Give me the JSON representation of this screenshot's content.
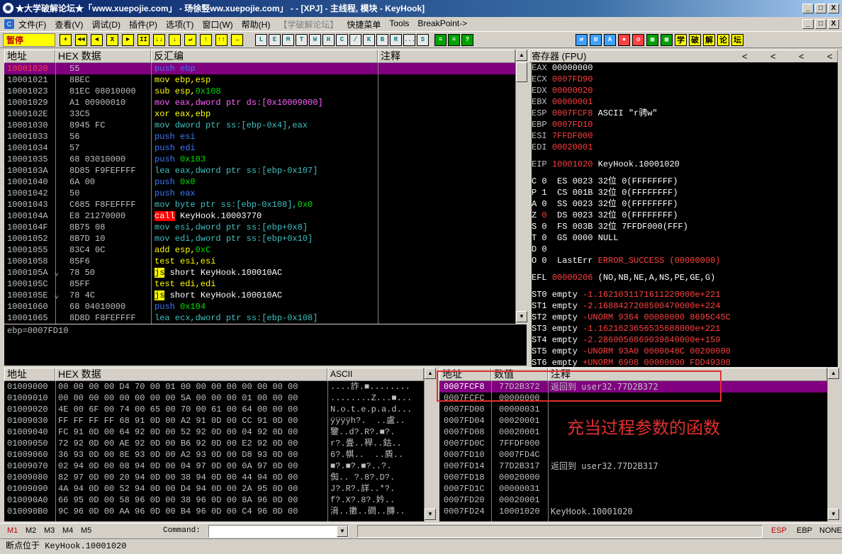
{
  "window": {
    "title": "★大学破解论坛★「www.xuepojie.com」 - 玚徐竪ww.xuepojie.com」 - - [XPJ] - 主线程, 模块 - KeyHook]",
    "min_label": "_",
    "max_label": "□",
    "close_label": "X"
  },
  "menu": [
    {
      "label": "文件(F)",
      "enabled": true
    },
    {
      "label": "查看(V)",
      "enabled": true
    },
    {
      "label": "调试(D)",
      "enabled": true
    },
    {
      "label": "插件(P)",
      "enabled": true
    },
    {
      "label": "选项(T)",
      "enabled": true
    },
    {
      "label": "窗口(W)",
      "enabled": true
    },
    {
      "label": "帮助(H)",
      "enabled": true
    },
    {
      "label": "【学破解论坛】",
      "enabled": false
    },
    {
      "label": "快捷菜单",
      "enabled": true
    },
    {
      "label": "Tools",
      "enabled": true
    },
    {
      "label": "BreakPoint->",
      "enabled": true
    }
  ],
  "toolbar": {
    "state": "暂停",
    "buttons_left": [
      "+",
      "◄◄",
      "◄",
      "X",
      "►",
      "II",
      "↓↓",
      "↓",
      "↵",
      "↑",
      "↑↑",
      "→"
    ],
    "buttons_letters": [
      "L",
      "E",
      "M",
      "T",
      "W",
      "H",
      "C",
      "/",
      "K",
      "B",
      "R",
      "...",
      "S"
    ],
    "buttons_right": [
      "≡",
      "≡",
      "?"
    ],
    "buttons_plugins": [
      "⇄",
      "⊞",
      "A",
      "●",
      "◎",
      "▦",
      "▦",
      "学",
      "破",
      "解",
      "论",
      "坛"
    ]
  },
  "disasm": {
    "headers": {
      "addr": "地址",
      "hex": "HEX 数据",
      "dis": "反汇编",
      "comment": "注释"
    },
    "rows": [
      {
        "addr": "10001020",
        "mark": "",
        "hex": "55",
        "parts": [
          {
            "t": "push ebp",
            "c": "blue"
          }
        ],
        "sel": true
      },
      {
        "addr": "10001021",
        "mark": "",
        "hex": "8BEC",
        "parts": [
          {
            "t": "mov ebp,esp",
            "c": "yellow"
          }
        ]
      },
      {
        "addr": "10001023",
        "mark": "",
        "hex": "81EC 08010000",
        "parts": [
          {
            "t": "sub esp,",
            "c": "yellow"
          },
          {
            "t": "0x108",
            "c": "green"
          }
        ]
      },
      {
        "addr": "10001029",
        "mark": "",
        "hex": "A1 00900010",
        "parts": [
          {
            "t": "mov eax,dword ptr ds:[0x10009000]",
            "c": "magenta"
          }
        ]
      },
      {
        "addr": "1000102E",
        "mark": "",
        "hex": "33C5",
        "parts": [
          {
            "t": "xor eax,ebp",
            "c": "yellow"
          }
        ]
      },
      {
        "addr": "10001030",
        "mark": "",
        "hex": "8945 FC",
        "parts": [
          {
            "t": "mov dword ptr ss:[ebp-0x4],eax",
            "c": "cyan"
          }
        ]
      },
      {
        "addr": "10001033",
        "mark": "",
        "hex": "56",
        "parts": [
          {
            "t": "push esi",
            "c": "blue"
          }
        ]
      },
      {
        "addr": "10001034",
        "mark": "",
        "hex": "57",
        "parts": [
          {
            "t": "push edi",
            "c": "blue"
          }
        ]
      },
      {
        "addr": "10001035",
        "mark": "",
        "hex": "68 03010000",
        "parts": [
          {
            "t": "push ",
            "c": "blue"
          },
          {
            "t": "0x103",
            "c": "green"
          }
        ]
      },
      {
        "addr": "1000103A",
        "mark": "",
        "hex": "8D85 F9FEFFFF",
        "parts": [
          {
            "t": "lea eax,dword ptr ss:[ebp-0x107]",
            "c": "cyan"
          }
        ]
      },
      {
        "addr": "10001040",
        "mark": "",
        "hex": "6A 00",
        "parts": [
          {
            "t": "push ",
            "c": "blue"
          },
          {
            "t": "0x0",
            "c": "green"
          }
        ]
      },
      {
        "addr": "10001042",
        "mark": "",
        "hex": "50",
        "parts": [
          {
            "t": "push eax",
            "c": "blue"
          }
        ]
      },
      {
        "addr": "10001043",
        "mark": "",
        "hex": "C685 F8FEFFFF",
        "parts": [
          {
            "t": "mov byte ptr ss:[ebp-0x108],",
            "c": "cyan"
          },
          {
            "t": "0x0",
            "c": "green"
          }
        ]
      },
      {
        "addr": "1000104A",
        "mark": "",
        "hex": "E8 21270000",
        "parts": [
          {
            "t": "call",
            "c": "hlred"
          },
          {
            "t": " KeyHook.10003770",
            "c": "white"
          }
        ]
      },
      {
        "addr": "1000104F",
        "mark": "",
        "hex": "8B75 08",
        "parts": [
          {
            "t": "mov esi,dword ptr ss:[ebp+0x8]",
            "c": "cyan"
          }
        ]
      },
      {
        "addr": "10001052",
        "mark": "",
        "hex": "8B7D 10",
        "parts": [
          {
            "t": "mov edi,dword ptr ss:[ebp+0x10]",
            "c": "cyan"
          }
        ]
      },
      {
        "addr": "10001055",
        "mark": "",
        "hex": "83C4 0C",
        "parts": [
          {
            "t": "add esp,",
            "c": "yellow"
          },
          {
            "t": "0xC",
            "c": "green"
          }
        ]
      },
      {
        "addr": "10001058",
        "mark": "",
        "hex": "85F6",
        "parts": [
          {
            "t": "test esi,esi",
            "c": "yellow"
          }
        ]
      },
      {
        "addr": "1000105A",
        "mark": "⌄",
        "hex": "78 50",
        "parts": [
          {
            "t": "js",
            "c": "hlyellow"
          },
          {
            "t": " short KeyHook.100010AC",
            "c": "white"
          }
        ]
      },
      {
        "addr": "1000105C",
        "mark": "",
        "hex": "85FF",
        "parts": [
          {
            "t": "test edi,edi",
            "c": "yellow"
          }
        ]
      },
      {
        "addr": "1000105E",
        "mark": "⌄",
        "hex": "78 4C",
        "parts": [
          {
            "t": "js",
            "c": "hlyellow"
          },
          {
            "t": " short KeyHook.100010AC",
            "c": "white"
          }
        ]
      },
      {
        "addr": "10001060",
        "mark": "",
        "hex": "68 04010000",
        "parts": [
          {
            "t": "push ",
            "c": "blue"
          },
          {
            "t": "0x104",
            "c": "green"
          }
        ]
      },
      {
        "addr": "10001065",
        "mark": "",
        "hex": "8D8D F8FEFFFF",
        "parts": [
          {
            "t": "lea ecx,dword ptr ss:[ebp-0x108]",
            "c": "cyan"
          }
        ]
      }
    ],
    "info": "ebp=0007FD10"
  },
  "registers": {
    "header": "寄存器 (FPU)",
    "arrows": [
      "<",
      "<",
      "<",
      "<"
    ],
    "lines": [
      [
        {
          "t": "EAX ",
          "c": "gray"
        },
        {
          "t": "00000000",
          "c": "white"
        }
      ],
      [
        {
          "t": "ECX ",
          "c": "gray"
        },
        {
          "t": "0007FD90",
          "c": "red"
        }
      ],
      [
        {
          "t": "EDX ",
          "c": "gray"
        },
        {
          "t": "00000020",
          "c": "red"
        }
      ],
      [
        {
          "t": "EBX ",
          "c": "gray"
        },
        {
          "t": "00000001",
          "c": "red"
        }
      ],
      [
        {
          "t": "ESP ",
          "c": "gray"
        },
        {
          "t": "0007FCF8",
          "c": "red"
        },
        {
          "t": " ASCII \"r骋w\"",
          "c": "white"
        }
      ],
      [
        {
          "t": "EBP ",
          "c": "gray"
        },
        {
          "t": "0007FD10",
          "c": "red"
        }
      ],
      [
        {
          "t": "ESI ",
          "c": "gray"
        },
        {
          "t": "7FFDF000",
          "c": "red"
        }
      ],
      [
        {
          "t": "EDI ",
          "c": "gray"
        },
        {
          "t": "00020001",
          "c": "red"
        }
      ],
      "gap",
      [
        {
          "t": "EIP ",
          "c": "gray"
        },
        {
          "t": "10001020",
          "c": "red"
        },
        {
          "t": " KeyHook.10001020",
          "c": "white"
        }
      ],
      "gap",
      [
        {
          "t": "C 0  ES 0023 32位 0(FFFFFFFF)",
          "c": "white"
        }
      ],
      [
        {
          "t": "P 1  CS 001B 32位 0(FFFFFFFF)",
          "c": "white"
        }
      ],
      [
        {
          "t": "A 0  SS 0023 32位 0(FFFFFFFF)",
          "c": "white"
        }
      ],
      [
        {
          "t": "Z ",
          "c": "white"
        },
        {
          "t": "0",
          "c": "red"
        },
        {
          "t": "  DS 0023 32位 0(FFFFFFFF)",
          "c": "white"
        }
      ],
      [
        {
          "t": "S 0  FS 003B 32位 7FFDF000(FFF)",
          "c": "white"
        }
      ],
      [
        {
          "t": "T 0  GS 0000 NULL",
          "c": "white"
        }
      ],
      [
        {
          "t": "D 0",
          "c": "white"
        }
      ],
      [
        {
          "t": "O 0  LastErr ",
          "c": "white"
        },
        {
          "t": "ERROR_SUCCESS (00000000)",
          "c": "red"
        }
      ],
      "gap",
      [
        {
          "t": "EFL ",
          "c": "white"
        },
        {
          "t": "00000206",
          "c": "red"
        },
        {
          "t": " (NO,NB,NE,A,NS,PE,GE,G)",
          "c": "white"
        }
      ],
      "gap",
      [
        {
          "t": "ST0 empty ",
          "c": "white"
        },
        {
          "t": "-1.1621031171611220000e+221",
          "c": "red"
        }
      ],
      [
        {
          "t": "ST1 empty ",
          "c": "white"
        },
        {
          "t": "-2.1688427208500470000e+224",
          "c": "red"
        }
      ],
      [
        {
          "t": "ST2 empty ",
          "c": "white"
        },
        {
          "t": "-UNORM 9364 00000000 8695C45C",
          "c": "red"
        }
      ],
      [
        {
          "t": "ST3 empty ",
          "c": "white"
        },
        {
          "t": "-1.1621623656535688000e+221",
          "c": "red"
        }
      ],
      [
        {
          "t": "ST4 empty ",
          "c": "white"
        },
        {
          "t": "-2.2860056869039840000e+159",
          "c": "red"
        }
      ],
      [
        {
          "t": "ST5 empty ",
          "c": "white"
        },
        {
          "t": "-UNORM 93A0 0000048C 00200000",
          "c": "red"
        }
      ],
      [
        {
          "t": "ST6 empty ",
          "c": "white"
        },
        {
          "t": "+UNORM 6908 00000000 FDD49308",
          "c": "red"
        }
      ]
    ]
  },
  "dump": {
    "headers": {
      "addr": "地址",
      "hex": "HEX 数据",
      "ascii": "ASCII"
    },
    "rows": [
      {
        "addr": "01009000",
        "hex": "00 00 00 00 D4 70 00 01 00 00 00 00 00 00 00 00",
        "ascii": "....詐.■........"
      },
      {
        "addr": "01009010",
        "hex": "00 00 00 00 00 00 00 00 5A 00 00 00 01 00 00 00",
        "ascii": "........Z...■..."
      },
      {
        "addr": "01009020",
        "hex": "4E 00 6F 00 74 00 65 00 70 00 61 00 64 00 00 00",
        "ascii": "N.o.t.e.p.a.d..."
      },
      {
        "addr": "01009030",
        "hex": "FF FF FF FF 68 91 0D 00 A2 91 0D 00 CC 91 0D 00",
        "ascii": "ÿÿÿÿh?.  ..盧.."
      },
      {
        "addr": "01009040",
        "hex": "FC 91 0D 00 64 92 0D 00 52 92 0D 00 04 92 0D 00",
        "ascii": "鑒..d?.R?.■?."
      },
      {
        "addr": "01009050",
        "hex": "72 92 0D 00 AE 92 0D 00 B6 92 0D 00 E2 92 0D 00",
        "ascii": "r?.畳..稈..鈷.."
      },
      {
        "addr": "01009060",
        "hex": "36 93 0D 00 8E 93 0D 00 A2 93 0D 00 D8 93 0D 00",
        "ascii": "6?.帺..  ..貭.."
      },
      {
        "addr": "01009070",
        "hex": "02 94 0D 00 08 94 0D 00 04 97 0D 00 0A 97 0D 00",
        "ascii": "■?.■?.■?..?."
      },
      {
        "addr": "01009080",
        "hex": "82 97 0D 00 20 94 0D 00 38 94 0D 00 44 94 0D 00",
        "ascii": "倁.. ?.8?.D?."
      },
      {
        "addr": "01009090",
        "hex": "4A 94 0D 00 52 94 0D 00 D4 94 0D 00 2A 95 0D 00",
        "ascii": "J?.R?.詳..*?."
      },
      {
        "addr": "010090A0",
        "hex": "66 95 0D 00 58 96 0D 00 38 96 0D 00 8A 96 0D 00",
        "ascii": "f?.X?.8?.妗.."
      },
      {
        "addr": "010090B0",
        "hex": "9C 96 0D 00 AA 96 0D 00 B4 96 0D 00 C4 96 0D 00",
        "ascii": "湇..擻..磵..膞.."
      }
    ]
  },
  "stack": {
    "headers": {
      "addr": "地址",
      "val": "数值",
      "comment": "注释"
    },
    "rows": [
      {
        "addr": "0007FCF8",
        "val": "77D2B372",
        "comment": "返回到 user32.77D2B372",
        "sel": true
      },
      {
        "addr": "0007FCFC",
        "val": "00000000",
        "comment": ""
      },
      {
        "addr": "0007FD00",
        "val": "00000031",
        "comment": ""
      },
      {
        "addr": "0007FD04",
        "val": "00020001",
        "comment": ""
      },
      {
        "addr": "0007FD08",
        "val": "00020001",
        "comment": ""
      },
      {
        "addr": "0007FD0C",
        "val": "7FFDF000",
        "comment": ""
      },
      {
        "addr": "0007FD10",
        "val": "0007FD4C",
        "comment": ""
      },
      {
        "addr": "0007FD14",
        "val": "77D2B317",
        "comment": "返回到 user32.77D2B317"
      },
      {
        "addr": "0007FD18",
        "val": "00020000",
        "comment": ""
      },
      {
        "addr": "0007FD1C",
        "val": "00000031",
        "comment": ""
      },
      {
        "addr": "0007FD20",
        "val": "00020001",
        "comment": ""
      },
      {
        "addr": "0007FD24",
        "val": "10001020",
        "comment": "KeyHook.10001020"
      }
    ]
  },
  "annotation": {
    "text": "充当过程参数的函数",
    "color": "#e03030"
  },
  "cmdbar": {
    "markers": [
      "M1",
      "M2",
      "M3",
      "M4",
      "M5"
    ],
    "command_label": "Command:",
    "command_value": "",
    "right": [
      "ESP",
      "EBP",
      "NONE"
    ]
  },
  "status": "断点位于 KeyHook.10001020",
  "colors": {
    "selection": "#800080",
    "accent_red": "#ff4040",
    "pause_bg": "#ffff00"
  }
}
